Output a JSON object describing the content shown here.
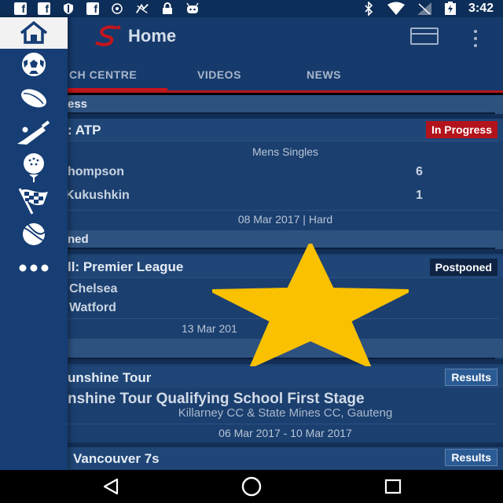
{
  "status_bar": {
    "time": "3:42",
    "left_icons": [
      "facebook-icon",
      "facebook-icon",
      "shield-icon",
      "facebook-icon",
      "sync-icon",
      "fancy-icon",
      "lock-icon",
      "android-icon"
    ],
    "right_icons": [
      "bluetooth-icon",
      "wifi-icon",
      "signal-icon",
      "battery-icon"
    ]
  },
  "app_bar": {
    "title": "Home",
    "logo_icon": "supersport-logo",
    "actions": [
      "calendar-icon",
      "more-vert-icon"
    ]
  },
  "tabs": [
    {
      "label": "MATCH CENTRE",
      "visible_text": "CH CENTRE",
      "active": true
    },
    {
      "label": "VIDEOS",
      "active": false
    },
    {
      "label": "NEWS",
      "active": false
    }
  ],
  "sidebar": {
    "items": [
      {
        "icon": "home-icon",
        "active": true
      },
      {
        "icon": "soccer-ball-icon",
        "active": false
      },
      {
        "icon": "rugby-ball-icon",
        "active": false
      },
      {
        "icon": "cricket-bat-icon",
        "active": false
      },
      {
        "icon": "golf-ball-icon",
        "active": false
      },
      {
        "icon": "checkered-flag-icon",
        "active": false
      },
      {
        "icon": "tennis-ball-icon",
        "active": false
      },
      {
        "icon": "more-horiz-icon",
        "active": false
      }
    ]
  },
  "sections": {
    "progress": {
      "header": "ess"
    },
    "postponed": {
      "header": "ned"
    }
  },
  "cards": {
    "atp": {
      "title": ": ATP",
      "badge": "In Progress",
      "subtitle": "Mens Singles",
      "player1": "hompson",
      "score1": "6",
      "player2": "Kukushkin",
      "score2": "1",
      "footer": "08 Mar 2017 |  Hard"
    },
    "premier": {
      "title": "ll: Premier League",
      "badge": "Postponed",
      "team1": "Chelsea",
      "team2": "Watford",
      "footer": "13 Mar 201"
    },
    "sunshine": {
      "title": "unshine Tour",
      "badge": "Results",
      "event": "nshine Tour Qualifying School First Stage",
      "venue": "Killarney CC & State Mines CC, Gauteng",
      "dates": "06 Mar 2017  -  10 Mar 2017"
    },
    "vancouver": {
      "title": "Vancouver 7s",
      "badge": "Results"
    }
  },
  "overlay": {
    "icon": "star-icon",
    "color": "#f9c100"
  },
  "nav_bar": {
    "buttons": [
      "back-icon",
      "home-circle-icon",
      "recents-icon"
    ]
  },
  "colors": {
    "accent_red": "#c4151c",
    "primary": "#163a6c"
  }
}
